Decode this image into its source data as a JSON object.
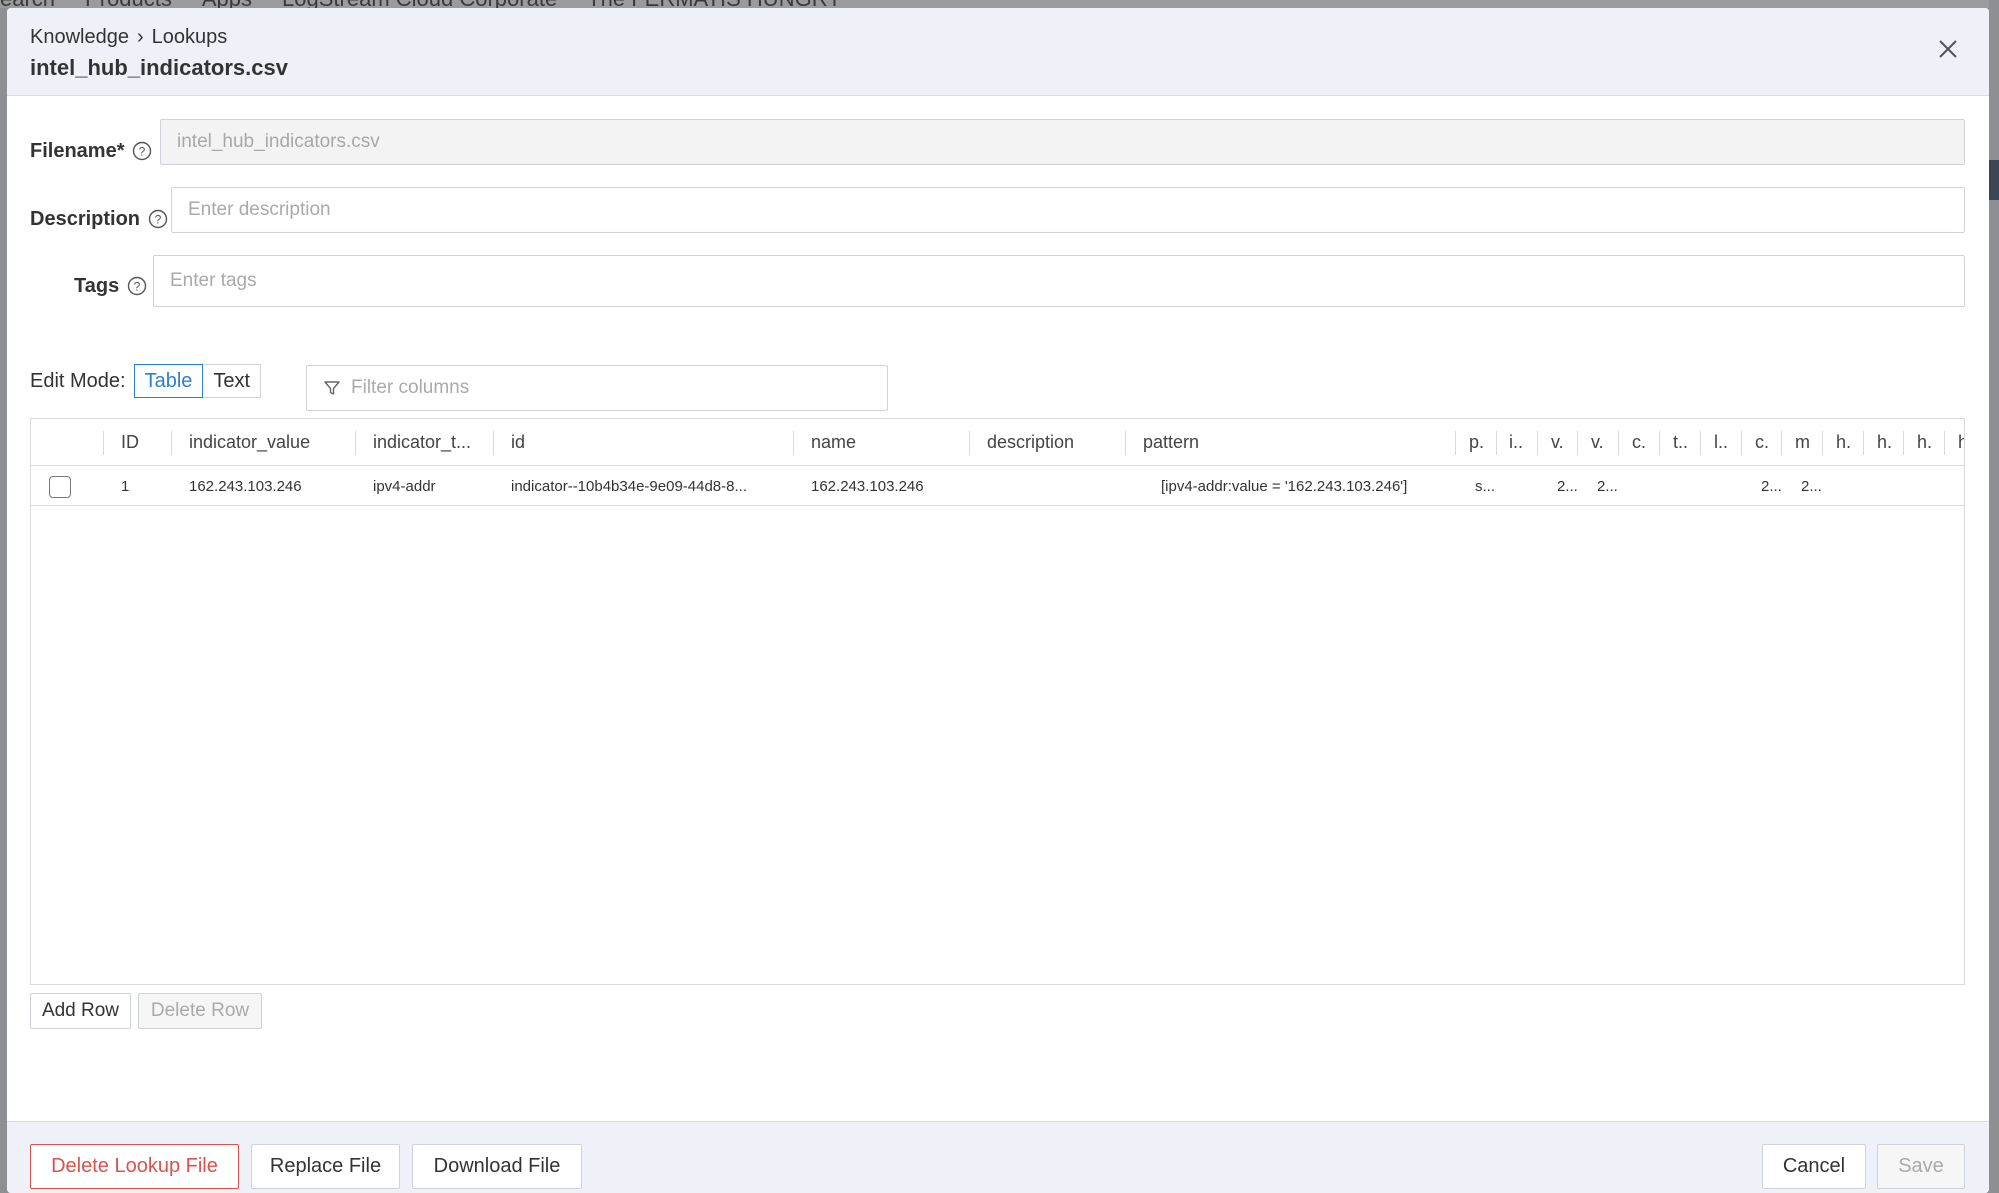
{
  "background_app": {
    "nav_items": [
      "earch",
      "Products",
      "Apps",
      "LogStream Cloud Corporate",
      "The FERMATIS HUNGRY"
    ]
  },
  "header": {
    "breadcrumb": [
      "Knowledge",
      "Lookups"
    ],
    "breadcrumb_separator": "›",
    "title": "intel_hub_indicators.csv"
  },
  "form": {
    "filename": {
      "label": "Filename*",
      "value": "intel_hub_indicators.csv"
    },
    "description": {
      "label": "Description",
      "placeholder": "Enter description"
    },
    "tags": {
      "label": "Tags",
      "placeholder": "Enter tags"
    }
  },
  "edit_mode": {
    "label": "Edit Mode:",
    "options": [
      "Table",
      "Text"
    ],
    "selected": "Table"
  },
  "filter": {
    "placeholder": "Filter columns"
  },
  "table": {
    "columns": [
      "ID",
      "indicator_value",
      "indicator_t...",
      "id",
      "name",
      "description",
      "pattern",
      "p.",
      "i..",
      "v.",
      "v.",
      "c.",
      "t..",
      "l..",
      "c.",
      "m",
      "h.",
      "h.",
      "h.",
      "h"
    ],
    "rows": [
      {
        "cells": [
          "1",
          "162.243.103.246",
          "ipv4-addr",
          "indicator--10b4b34e-9e09-44d8-8...",
          "162.243.103.246",
          "",
          "[ipv4-addr:value = '162.243.103.246']",
          "s...",
          "",
          "2...",
          "2...",
          "",
          "",
          "",
          "2...",
          "2...",
          "",
          "",
          "",
          ""
        ]
      }
    ]
  },
  "row_actions": {
    "add": "Add Row",
    "delete": "Delete Row"
  },
  "footer": {
    "delete": "Delete Lookup File",
    "replace": "Replace File",
    "download": "Download File",
    "cancel": "Cancel",
    "save": "Save"
  },
  "colors": {
    "accent": "#2b7fd6",
    "danger": "#d9534f",
    "header_bg": "#eef2f8"
  }
}
